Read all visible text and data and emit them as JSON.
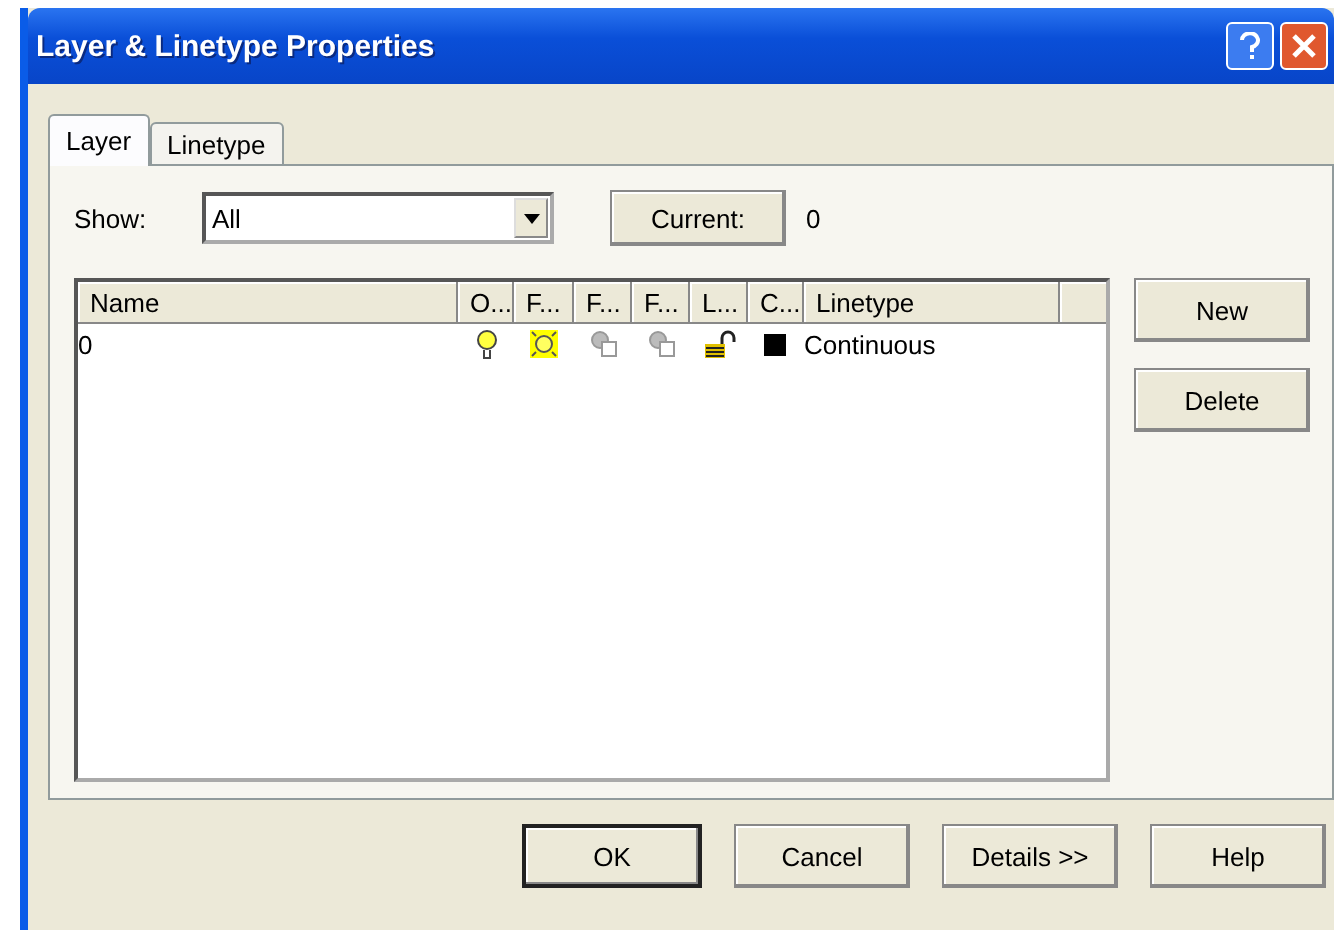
{
  "window": {
    "title": "Layer & Linetype Properties"
  },
  "tabs": [
    {
      "label": "Layer",
      "selected": true
    },
    {
      "label": "Linetype",
      "selected": false
    }
  ],
  "show": {
    "label": "Show:",
    "value": "All"
  },
  "current": {
    "button": "Current:",
    "value": "0"
  },
  "table": {
    "columns": [
      "Name",
      "O...",
      "F...",
      "F...",
      "F...",
      "L...",
      "C...",
      "Linetype"
    ],
    "rows": [
      {
        "name": "0",
        "on": true,
        "frozen": false,
        "frozen_current": false,
        "frozen_new": false,
        "locked": false,
        "color": "#000000",
        "linetype": "Continuous"
      }
    ]
  },
  "side_buttons": [
    "New",
    "Delete"
  ],
  "buttons": [
    {
      "label": "OK",
      "default": true
    },
    {
      "label": "Cancel",
      "default": false
    },
    {
      "label": "Details >>",
      "default": false
    },
    {
      "label": "Help",
      "default": false
    }
  ]
}
